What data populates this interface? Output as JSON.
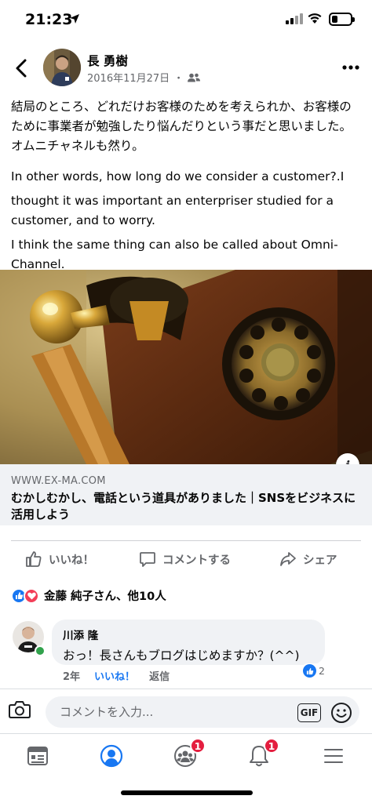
{
  "status_bar": {
    "time": "21:23",
    "battery_level": 0.3
  },
  "post": {
    "author": "長 勇樹",
    "date": "2016年11月27日",
    "separator": "・",
    "audience_icon": "friends-icon",
    "text": {
      "jp_line1": "結局のところ、どれだけお客様のためを考えられか、お客様のために事業者が勉強したり悩んだりという事だと思いました。",
      "jp_line2": "オムニチャネルも然り。",
      "en_line1": "In other words, how long do we consider a customer?.I",
      "en_line2": "thought it was important an enterpriser studied for a customer, and to worry.",
      "en_line3": "I think the same thing can also be called about Omni-Channel."
    },
    "link": {
      "domain": "WWW.EX-MA.COM",
      "title": "むかしむかし、電話という道具がありました｜SNSをビジネスに活用しよう",
      "info_label": "i"
    }
  },
  "actions": {
    "like": "いいね！",
    "comment": "コメントする",
    "share": "シェア"
  },
  "reactions": {
    "summary": "金藤 純子さん、他10人"
  },
  "comment": {
    "author": "川添 隆",
    "text": "おっ！長さんもブログはじめますか？(^^)",
    "age": "2年",
    "like_label": "いいね！",
    "reply_label": "返信",
    "like_count": "2"
  },
  "composer": {
    "placeholder": "コメントを入力...",
    "gif_label": "GIF"
  },
  "bottom_nav": {
    "groups_badge": "1",
    "notifications_badge": "1"
  }
}
